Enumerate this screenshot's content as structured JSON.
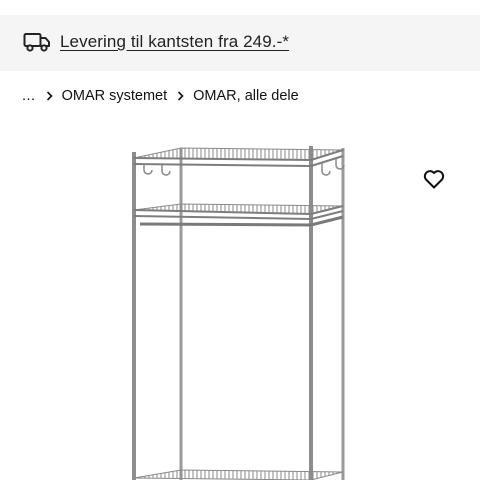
{
  "delivery_banner": {
    "icon": "delivery-truck-icon",
    "text": "Levering til kantsten fra 249.-*"
  },
  "breadcrumb": {
    "ellipsis": "...",
    "items": [
      {
        "label": "OMAR systemet"
      },
      {
        "label": "OMAR, alle dele"
      }
    ],
    "separator_icon": "chevron-right-icon"
  },
  "product": {
    "image_icon": "wire-shelving-unit-image",
    "favourite_icon": "heart-outline-icon"
  },
  "colors": {
    "banner_background": "#f5f5f5",
    "text": "#111111",
    "metal": "#9a9a9a"
  }
}
